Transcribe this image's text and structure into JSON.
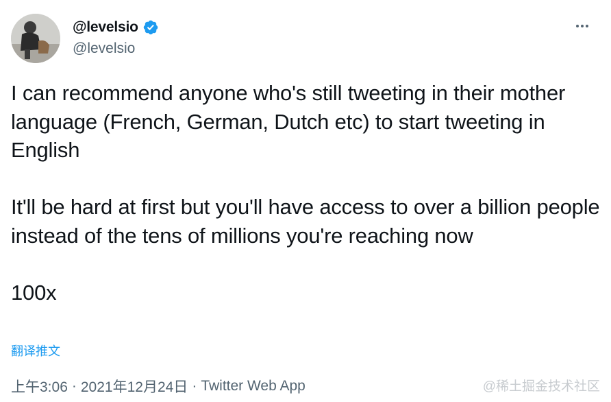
{
  "author": {
    "display_name": "@levelsio",
    "handle": "@levelsio",
    "verified": true,
    "avatar_icon": "avatar-photo"
  },
  "menu": {
    "icon": "more-horizontal-icon"
  },
  "tweet": {
    "paragraphs": [
      "I can recommend anyone who's still tweeting in their mother language (French, German, Dutch etc) to start tweeting in English",
      "It'll be hard at first but you'll have access to over a billion people instead of the tens of millions you're reaching now",
      "100x"
    ],
    "translate_label": "翻译推文"
  },
  "meta": {
    "time": "上午3:06",
    "separator": "·",
    "date": "2021年12月24日",
    "source": "Twitter Web App"
  },
  "watermark": "@稀土掘金技术社区",
  "colors": {
    "accent": "#1d9bf0",
    "text_primary": "#0f1419",
    "text_secondary": "#536471"
  }
}
